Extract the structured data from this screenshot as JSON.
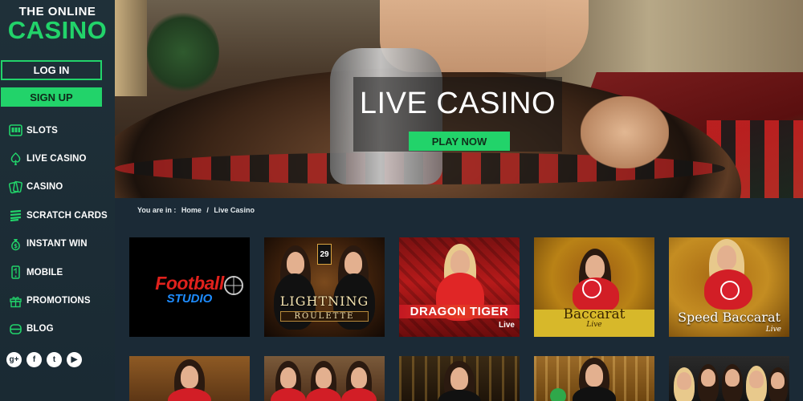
{
  "logo": {
    "line1": "THE ONLINE",
    "line2": "CASINO"
  },
  "auth": {
    "login": "LOG IN",
    "signup": "SIGN UP"
  },
  "nav": [
    {
      "label": "SLOTS",
      "icon": "slots-icon"
    },
    {
      "label": "LIVE CASINO",
      "icon": "live-casino-icon"
    },
    {
      "label": "CASINO",
      "icon": "cards-icon"
    },
    {
      "label": "SCRATCH CARDS",
      "icon": "scratch-cards-icon"
    },
    {
      "label": "INSTANT WIN",
      "icon": "money-bag-icon"
    },
    {
      "label": "MOBILE",
      "icon": "mobile-icon"
    },
    {
      "label": "PROMOTIONS",
      "icon": "gift-icon"
    },
    {
      "label": "BLOG",
      "icon": "blog-icon"
    }
  ],
  "social": [
    {
      "icon": "google-plus-icon",
      "glyph": "g+"
    },
    {
      "icon": "facebook-icon",
      "glyph": "f"
    },
    {
      "icon": "twitter-icon",
      "glyph": "t"
    },
    {
      "icon": "youtube-icon",
      "glyph": "▶"
    }
  ],
  "hero": {
    "title": "LIVE CASINO",
    "cta": "PLAY NOW"
  },
  "breadcrumb": {
    "prefix": "You are in :",
    "home": "Home",
    "separator": "/",
    "current": "Live Casino"
  },
  "games": [
    {
      "title_line1": "Football",
      "title_line2": "STUDIO"
    },
    {
      "title_line1": "LIGHTNING",
      "title_line2": "ROULETTE",
      "number": "29"
    },
    {
      "title_line1": "DRAGON TIGER",
      "title_line2": "Live"
    },
    {
      "title_line1": "Baccarat",
      "title_line2": "Live"
    },
    {
      "title_line1": "Speed Baccarat",
      "title_line2": "Live"
    }
  ],
  "colors": {
    "accent": "#22d36a",
    "sidebar": "#1f3039",
    "content_bg": "#1b2a36"
  }
}
